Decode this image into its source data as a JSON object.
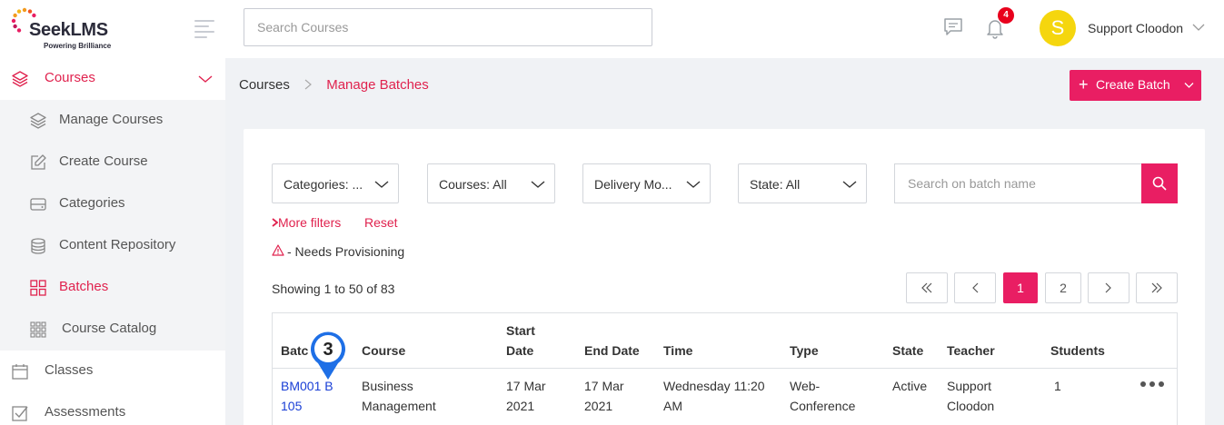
{
  "header": {
    "logo": {
      "name": "SeekLMS",
      "tagline": "Powering Brilliance"
    },
    "search_placeholder": "Search Courses",
    "notification_count": "4",
    "user": {
      "initial": "S",
      "name": "Support Cloodon",
      "avatar_color": "#f5d60e"
    }
  },
  "sidebar": {
    "items": [
      {
        "label": "Courses",
        "icon": "layers-icon",
        "active": true
      },
      {
        "label": "Manage Courses",
        "icon": "layers-icon"
      },
      {
        "label": "Create Course",
        "icon": "edit-icon"
      },
      {
        "label": "Categories",
        "icon": "drive-icon"
      },
      {
        "label": "Content Repository",
        "icon": "database-icon"
      },
      {
        "label": "Batches",
        "icon": "grid-icon",
        "active": true
      },
      {
        "label": "Course Catalog",
        "icon": "apps-grid-icon"
      },
      {
        "label": "Classes",
        "icon": "calendar-icon"
      },
      {
        "label": "Assessments",
        "icon": "checkbox-icon"
      }
    ]
  },
  "breadcrumb": {
    "root": "Courses",
    "current": "Manage Batches"
  },
  "create_button": {
    "label": "Create Batch"
  },
  "filters": {
    "categories": "Categories: ...",
    "courses": "Courses: All",
    "delivery_mode": "Delivery Mo...",
    "state": "State: All",
    "search_placeholder": "Search on batch name",
    "more_filters": "More filters",
    "reset": "Reset",
    "legend": "- Needs Provisioning"
  },
  "pagination": {
    "showing": "Showing 1 to 50 of 83",
    "pages": [
      "1",
      "2"
    ],
    "current_page": "1"
  },
  "table": {
    "columns": {
      "batch": "Batc",
      "course": "Course",
      "start_date_l1": "Start",
      "start_date_l2": "Date",
      "end_date": "End Date",
      "time": "Time",
      "type": "Type",
      "state": "State",
      "teacher": "Teacher",
      "students": "Students"
    },
    "rows": [
      {
        "batch_l1": "BM001 B",
        "batch_l2": "105",
        "course_l1": "Business",
        "course_l2": "Management",
        "start_l1": "17 Mar",
        "start_l2": "2021",
        "end_l1": "17 Mar",
        "end_l2": "2021",
        "time_l1": "Wednesday 11:20",
        "time_l2": "AM",
        "type_l1": "Web-",
        "type_l2": "Conference",
        "state": "Active",
        "teacher_l1": "Support",
        "teacher_l2": "Cloodon",
        "students": "1"
      }
    ]
  },
  "step_marker": {
    "number": "3",
    "color": "#1e6fe6"
  },
  "colors": {
    "accent": "#e91e63",
    "link": "#1a3fd6"
  }
}
